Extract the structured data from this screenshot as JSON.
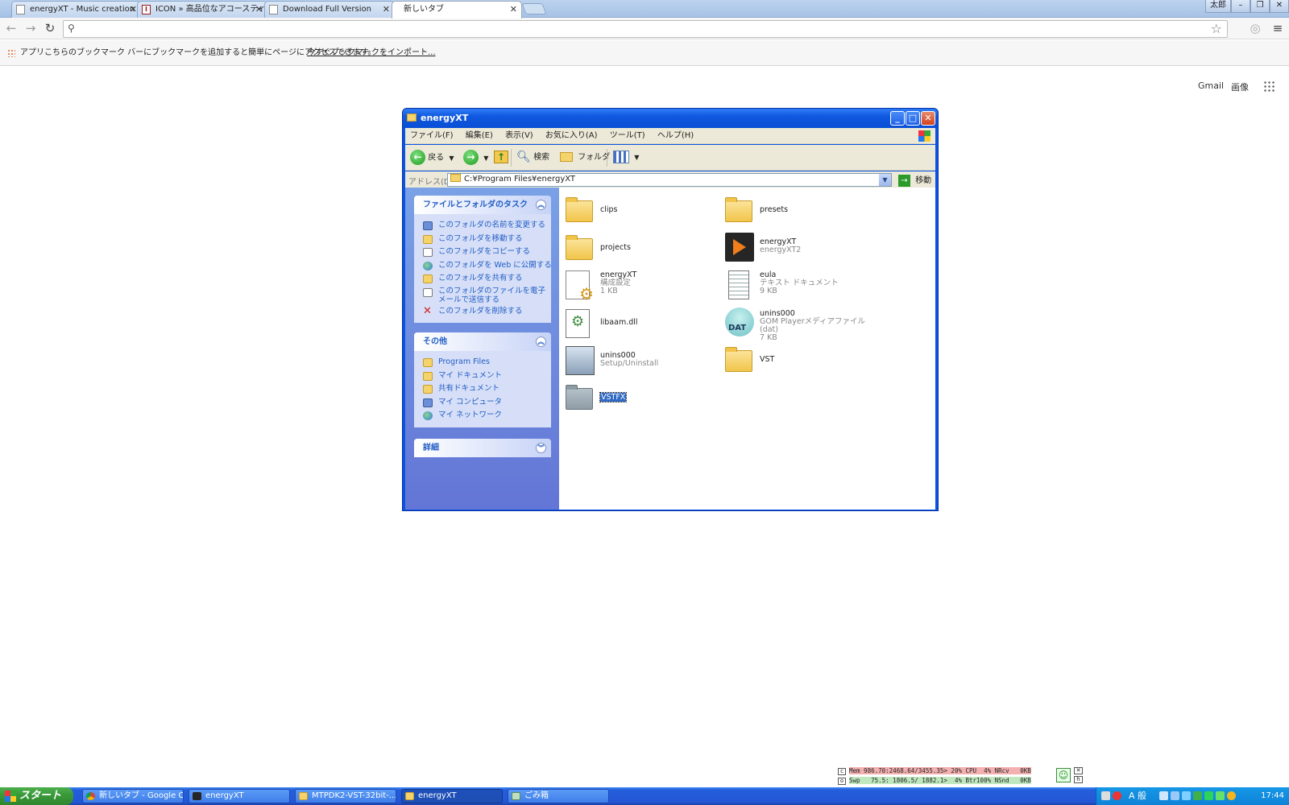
{
  "browser": {
    "tabs": [
      {
        "title": "energyXT - Music creation",
        "favicon": "doc-icon"
      },
      {
        "title": "ICON » 高品位なアコースティ",
        "favicon": "ic-logo-icon"
      },
      {
        "title": "Download Full Version",
        "favicon": "doc-icon"
      },
      {
        "title": "新しいタブ",
        "favicon": "none"
      }
    ],
    "user_button": "太郎",
    "omnibox_value": "",
    "bookmarks": {
      "apps_label": "アプリ",
      "hint": "こちらのブックマーク バーにブックマークを追加すると簡単にページにアクセスできます。",
      "import_link": "今すぐブックマークをインポート..."
    },
    "ntp": {
      "gmail": "Gmail",
      "images": "画像"
    }
  },
  "explorer": {
    "title": "energyXT",
    "menu": [
      "ファイル(F)",
      "編集(E)",
      "表示(V)",
      "お気に入り(A)",
      "ツール(T)",
      "ヘルプ(H)"
    ],
    "toolbar": {
      "back": "戻る",
      "search": "検索",
      "folders": "フォルダ"
    },
    "address": {
      "label": "アドレス(D)",
      "value": "C:¥Program Files¥energyXT",
      "go": "移動"
    },
    "tasks_panel": {
      "title": "ファイルとフォルダのタスク",
      "items": [
        {
          "label": "このフォルダの名前を変更する",
          "icon": "rename-icon"
        },
        {
          "label": "このフォルダを移動する",
          "icon": "move-icon"
        },
        {
          "label": "このフォルダをコピーする",
          "icon": "copy-icon"
        },
        {
          "label": "このフォルダを Web に公開する",
          "icon": "globe-icon"
        },
        {
          "label": "このフォルダを共有する",
          "icon": "share-icon"
        },
        {
          "label": "このフォルダのファイルを電子メールで送信する",
          "icon": "email-icon"
        },
        {
          "label": "このフォルダを削除する",
          "icon": "delete-icon"
        }
      ]
    },
    "other_panel": {
      "title": "その他",
      "items": [
        "Program Files",
        "マイ ドキュメント",
        "共有ドキュメント",
        "マイ コンピュータ",
        "マイ ネットワーク"
      ]
    },
    "details_panel": {
      "title": "詳細"
    },
    "files": [
      {
        "name": "clips",
        "lines": [],
        "icon": "folder-icon"
      },
      {
        "name": "presets",
        "lines": [],
        "icon": "folder-icon"
      },
      {
        "name": "projects",
        "lines": [],
        "icon": "folder-icon"
      },
      {
        "name": "energyXT",
        "lines": [
          "energyXT2"
        ],
        "icon": "energyxt-app-icon"
      },
      {
        "name": "energyXT",
        "lines": [
          "構成設定",
          "1 KB"
        ],
        "icon": "config-file-icon"
      },
      {
        "name": "eula",
        "lines": [
          "テキスト ドキュメント",
          "9 KB"
        ],
        "icon": "text-document-icon"
      },
      {
        "name": "libaam.dll",
        "lines": [],
        "icon": "dll-file-icon"
      },
      {
        "name": "unins000",
        "lines": [
          "GOM Playerメディアファイル(dat)",
          "7 KB"
        ],
        "icon": "dat-file-icon"
      },
      {
        "name": "unins000",
        "lines": [
          "Setup/Uninstall"
        ],
        "icon": "setup-icon"
      },
      {
        "name": "VST",
        "lines": [],
        "icon": "folder-icon"
      },
      {
        "name": "VSTFX",
        "lines": [],
        "icon": "folder-icon",
        "selected": true
      }
    ]
  },
  "perf": {
    "row1": "Mem 986.70:2468.64/3455.35> 20% CPU  4% NRcv   0KB",
    "row2": "Swp   75.5: 1806.5/ 1882.1>  4% Btr100% NSnd   0KB"
  },
  "taskbar": {
    "start": "スタート",
    "tasks": [
      {
        "label": "新しいタブ - Google C...",
        "icon": "chrome-icon"
      },
      {
        "label": "energyXT",
        "icon": "energyxt-icon"
      },
      {
        "label": "MTPDK2-VST-32bit-...",
        "icon": "folder-icon"
      },
      {
        "label": "energyXT",
        "icon": "folder-icon",
        "active": true
      },
      {
        "label": "ごみ箱",
        "icon": "recycle-bin-icon"
      }
    ],
    "ime": "A 般",
    "clock": "17:44"
  }
}
